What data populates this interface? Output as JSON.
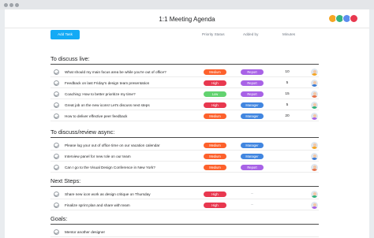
{
  "window": {
    "title": "1:1 Meeting Agenda"
  },
  "toolbar": {
    "add_task": "Add Task"
  },
  "columns": {
    "priority": "Priority Status",
    "added_by": "Added by",
    "minutes": "Minutes"
  },
  "colors": {
    "High": "#e8384f",
    "Medium": "#fd612c",
    "Low": "#62d26f",
    "Report": "#a862e6",
    "Manager": "#4186e0"
  },
  "sections": [
    {
      "title": "To discuss live:",
      "tasks": [
        {
          "name": "What should my main focus area be while you're out of office?",
          "priority": "Medium",
          "added_by": "Report",
          "minutes": "10"
        },
        {
          "name": "Feedback on last Friday's design team presentation",
          "priority": "High",
          "added_by": "Report",
          "minutes": "5"
        },
        {
          "name": "Coaching: How to better prioritize my time?",
          "priority": "Low",
          "added_by": "Report",
          "minutes": "15"
        },
        {
          "name": "Great job on the new icons! Let's discuss next steps",
          "priority": "High",
          "added_by": "Manager",
          "minutes": "5"
        },
        {
          "name": "How to deliver effective peer feedback",
          "priority": "Medium",
          "added_by": "Manager",
          "minutes": "20"
        }
      ]
    },
    {
      "title": "To discuss/review async:",
      "tasks": [
        {
          "name": "Please log your out of office time on our vacation calendar",
          "priority": "Medium",
          "added_by": "Manager",
          "minutes": ""
        },
        {
          "name": "Interview panel for new role on our team",
          "priority": "Medium",
          "added_by": "Manager",
          "minutes": ""
        },
        {
          "name": "Can I go to the Visual Design Conference in New York?",
          "priority": "Medium",
          "added_by": "Report",
          "minutes": ""
        }
      ]
    },
    {
      "title": "Next Steps:",
      "tasks": [
        {
          "name": "Share new icon work as design critique on Thursday",
          "priority": "High",
          "added_by": "",
          "minutes": ""
        },
        {
          "name": "Finalize sprint plan and share with team",
          "priority": "High",
          "added_by": "",
          "minutes": ""
        }
      ]
    },
    {
      "title": "Goals:",
      "tasks": [
        {
          "name": "Mentor another designer",
          "priority": "",
          "added_by": "",
          "minutes": ""
        }
      ]
    }
  ]
}
